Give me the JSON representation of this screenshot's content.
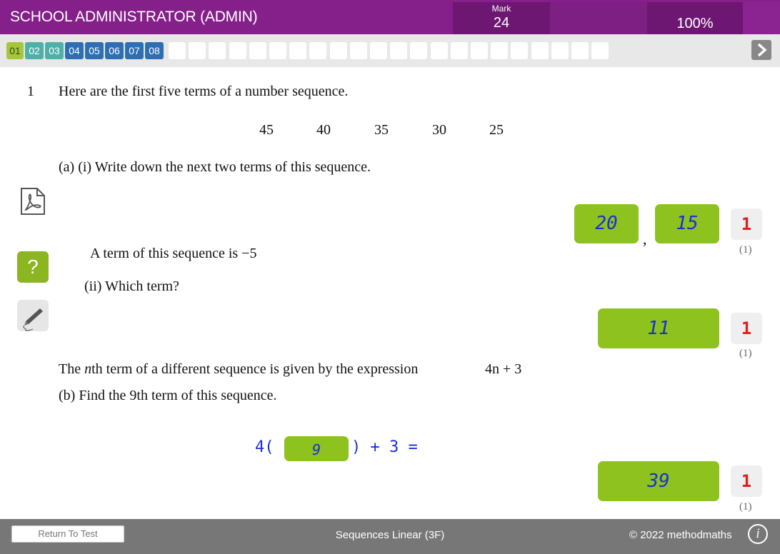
{
  "header": {
    "user_title": "SCHOOL ADMINISTRATOR (ADMIN)",
    "mark_label": "Mark",
    "mark_value": "24",
    "percent": "100%"
  },
  "nav": {
    "questions": [
      "01",
      "02",
      "03",
      "04",
      "05",
      "06",
      "07",
      "08"
    ],
    "question_colors": [
      "#a8c63a",
      "#4fb0a8",
      "#4fb0a8",
      "#2e6fb3",
      "#2e6fb3",
      "#2e6fb3",
      "#2e6fb3",
      "#2e6fb3"
    ],
    "next_icon": "chevron-right-icon"
  },
  "tools": {
    "pdf_icon": "pdf-icon",
    "help_label": "?",
    "pen_icon": "pen-icon"
  },
  "question": {
    "number": "1",
    "intro": "Here are the first five terms of a number sequence.",
    "sequence": [
      "45",
      "40",
      "35",
      "30",
      "25"
    ],
    "part_a_i": "(a)  (i)   Write down the next two terms of this sequence.",
    "part_a_ii_intro": "A term of this sequence is −5",
    "part_a_ii": "(ii)   Which term?",
    "part_b_intro_pre": "The ",
    "part_b_intro_n": "n",
    "part_b_intro_post": "th term of a different sequence is given by the expression",
    "part_b_expr": "4n + 3",
    "part_b": "(b)  Find the 9th term of this sequence.",
    "working_prefix": "4(",
    "working_value": "9",
    "working_suffix": ") + 3 ="
  },
  "answers": {
    "a_i_first": "20",
    "a_i_separator": ",",
    "a_i_second": "15",
    "a_ii": "11",
    "b": "39"
  },
  "marks": {
    "awarded": [
      "1",
      "1",
      "1"
    ],
    "max": [
      "(1)",
      "(1)",
      "(1)"
    ]
  },
  "footer": {
    "return_label": "Return To Test",
    "title": "Sequences Linear (3F)",
    "copyright": "© 2022 methodmaths",
    "info_label": "i"
  }
}
